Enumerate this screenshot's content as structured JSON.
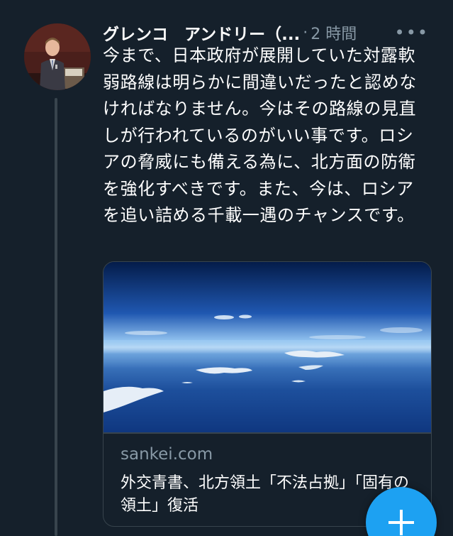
{
  "tweet": {
    "author": "グレンコ　アンドリー（...",
    "separator": "·",
    "time": "2 時間",
    "more_icon": "more-horizontal-icon",
    "text": "今まで、日本政府が展開していた対露軟弱路線は明らかに間違いだったと認めなければなりません。今はその路線の見直しが行われているのがいい事です。ロシアの脅威にも備える為に、北方面の防衛を強化すべきです。また、今は、ロシアを追い詰める千載一遇のチャンスです。"
  },
  "card": {
    "domain": "sankei.com",
    "title": "外交青書、北方領土「不法占拠」「固有の領土」復活"
  },
  "fab": {
    "icon": "plus-icon"
  },
  "colors": {
    "background": "#15202b",
    "muted_text": "#8899a6",
    "border": "#38444d",
    "accent": "#1da1f2"
  }
}
